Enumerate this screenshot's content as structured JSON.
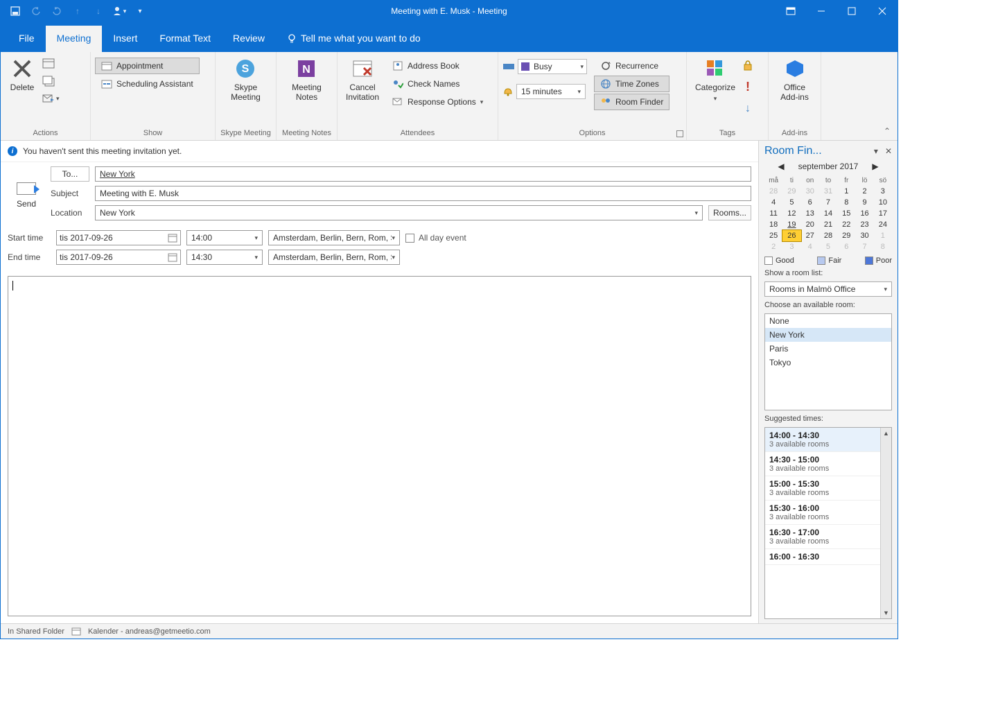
{
  "titlebar": {
    "title": "Meeting with E. Musk  -  Meeting"
  },
  "tabs": {
    "file": "File",
    "meeting": "Meeting",
    "insert": "Insert",
    "format": "Format Text",
    "review": "Review",
    "tellme": "Tell me what you want to do"
  },
  "ribbon": {
    "delete": "Delete",
    "appointment": "Appointment",
    "scheduling": "Scheduling Assistant",
    "skype": "Skype\nMeeting",
    "notes": "Meeting\nNotes",
    "cancel": "Cancel\nInvitation",
    "address_book": "Address Book",
    "check_names": "Check Names",
    "response_opts": "Response Options",
    "busy": "Busy",
    "reminder": "15 minutes",
    "recurrence": "Recurrence",
    "timezones": "Time Zones",
    "roomfinder": "Room Finder",
    "categorize": "Categorize",
    "addins": "Office\nAdd-ins",
    "groups": {
      "actions": "Actions",
      "show": "Show",
      "skype": "Skype Meeting",
      "notes": "Meeting Notes",
      "attendees": "Attendees",
      "options": "Options",
      "tags": "Tags",
      "addins": "Add-ins"
    }
  },
  "infobar": "You haven't sent this meeting invitation yet.",
  "form": {
    "send": "Send",
    "to_btn": "To...",
    "to_val": "New York",
    "subject_lbl": "Subject",
    "subject_val": "Meeting with E. Musk",
    "location_lbl": "Location",
    "location_val": "New York",
    "rooms_btn": "Rooms...",
    "start_lbl": "Start time",
    "end_lbl": "End time",
    "start_date": "tis 2017-09-26",
    "end_date": "tis 2017-09-26",
    "start_time": "14:00",
    "end_time": "14:30",
    "tz": "Amsterdam, Berlin, Bern, Rom, St",
    "allday": "All day event"
  },
  "roomfinder": {
    "title": "Room Fin...",
    "month": "september 2017",
    "dow": [
      "må",
      "ti",
      "on",
      "to",
      "fr",
      "lö",
      "sö"
    ],
    "weeks": [
      [
        {
          "n": "28",
          "off": true
        },
        {
          "n": "29",
          "off": true
        },
        {
          "n": "30",
          "off": true
        },
        {
          "n": "31",
          "off": true
        },
        {
          "n": "1"
        },
        {
          "n": "2"
        },
        {
          "n": "3"
        }
      ],
      [
        {
          "n": "4"
        },
        {
          "n": "5"
        },
        {
          "n": "6"
        },
        {
          "n": "7"
        },
        {
          "n": "8"
        },
        {
          "n": "9"
        },
        {
          "n": "10"
        }
      ],
      [
        {
          "n": "11"
        },
        {
          "n": "12"
        },
        {
          "n": "13"
        },
        {
          "n": "14"
        },
        {
          "n": "15"
        },
        {
          "n": "16"
        },
        {
          "n": "17"
        }
      ],
      [
        {
          "n": "18"
        },
        {
          "n": "19",
          "ul": true
        },
        {
          "n": "20"
        },
        {
          "n": "21"
        },
        {
          "n": "22"
        },
        {
          "n": "23"
        },
        {
          "n": "24"
        }
      ],
      [
        {
          "n": "25"
        },
        {
          "n": "26",
          "today": true
        },
        {
          "n": "27"
        },
        {
          "n": "28"
        },
        {
          "n": "29"
        },
        {
          "n": "30"
        },
        {
          "n": "1",
          "off": true
        }
      ],
      [
        {
          "n": "2",
          "off": true
        },
        {
          "n": "3",
          "off": true
        },
        {
          "n": "4",
          "off": true
        },
        {
          "n": "5",
          "off": true
        },
        {
          "n": "6",
          "off": true
        },
        {
          "n": "7",
          "off": true
        },
        {
          "n": "8",
          "off": true
        }
      ]
    ],
    "legend": {
      "good": "Good",
      "fair": "Fair",
      "poor": "Poor"
    },
    "show_list_lbl": "Show a room list:",
    "room_list": "Rooms in Malmö Office",
    "choose_lbl": "Choose an available room:",
    "rooms": [
      "None",
      "New York",
      "Paris",
      "Tokyo"
    ],
    "room_selected": 1,
    "suggested_lbl": "Suggested times:",
    "suggested": [
      {
        "t": "14:00 - 14:30",
        "s": "3 available rooms",
        "sel": true
      },
      {
        "t": "14:30 - 15:00",
        "s": "3 available rooms"
      },
      {
        "t": "15:00 - 15:30",
        "s": "3 available rooms"
      },
      {
        "t": "15:30 - 16:00",
        "s": "3 available rooms"
      },
      {
        "t": "16:30 - 17:00",
        "s": "3 available rooms"
      },
      {
        "t": "16:00 - 16:30",
        "s": ""
      }
    ]
  },
  "status": {
    "folder": "In Shared Folder",
    "calendar": "Kalender - andreas@getmeetio.com"
  }
}
